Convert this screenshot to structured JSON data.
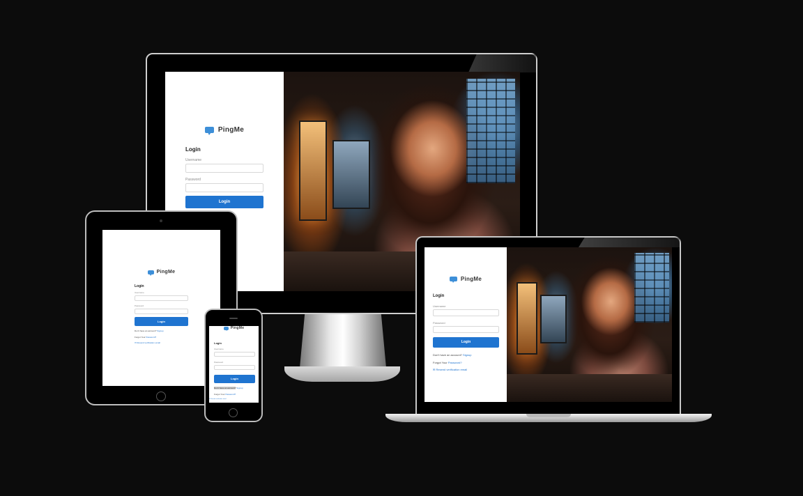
{
  "app": {
    "brand": "PingMe",
    "login_heading": "Login",
    "username_label": "Username",
    "password_label": "Password",
    "login_button": "Login",
    "no_account_text": "Don't have an account?",
    "signup_link": "Signup",
    "forgot_text": "Forgot Your",
    "forgot_link": "Password?",
    "resend_link": "Resend verification email"
  },
  "colors": {
    "background": "#0c0c0c",
    "primary_button": "#1f74d0",
    "logo": "#3d8fd8",
    "panel": "#ffffff"
  },
  "devices": [
    "desktop-monitor",
    "tablet",
    "smartphone",
    "laptop"
  ]
}
